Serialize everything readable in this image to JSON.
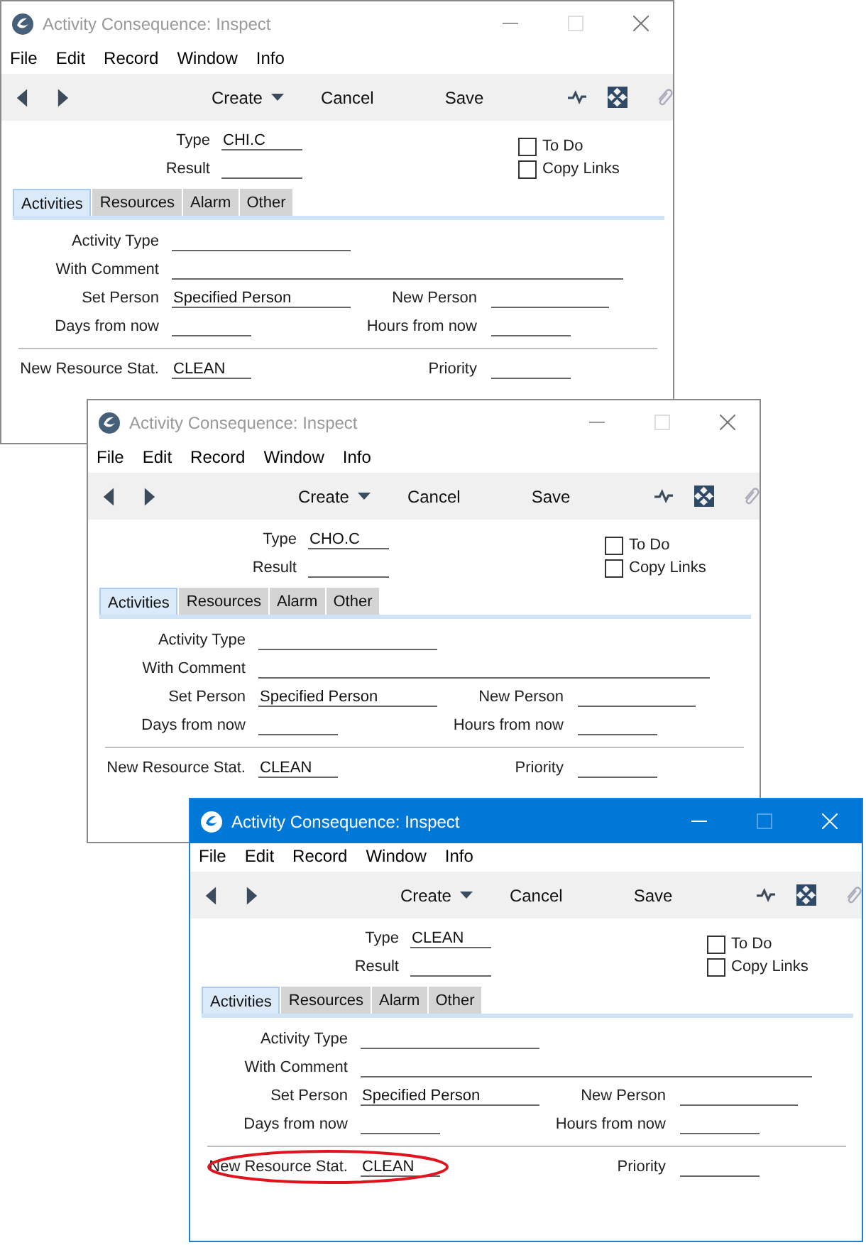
{
  "windows": [
    {
      "title": "Activity Consequence: Inspect",
      "active": false,
      "menu": [
        "File",
        "Edit",
        "Record",
        "Window",
        "Info"
      ],
      "toolbar": {
        "create": "Create",
        "cancel": "Cancel",
        "save": "Save"
      },
      "header_fields": [
        {
          "label": "Type",
          "value": "CHI.C"
        },
        {
          "label": "Result"
        }
      ],
      "checkboxes": [
        {
          "label": "To Do",
          "checked": false
        },
        {
          "label": "Copy Links",
          "checked": false
        }
      ],
      "tabs": [
        {
          "label": "Activities",
          "selected": true
        },
        {
          "label": "Resources",
          "selected": false
        },
        {
          "label": "Alarm",
          "selected": false
        },
        {
          "label": "Other",
          "selected": false
        }
      ],
      "rows": [
        {
          "left": {
            "label": "Activity Type",
            "kind": "medium"
          }
        },
        {
          "left": {
            "label": "With Comment",
            "kind": "wide"
          }
        },
        {
          "left": {
            "label": "Set Person",
            "value": "Specified Person",
            "kind": "medium"
          },
          "right": {
            "label": "New Person",
            "kind": "narrow"
          }
        },
        {
          "left": {
            "label": "Days from now",
            "kind": "short"
          },
          "right": {
            "label": "Hours from now",
            "kind": "short"
          }
        }
      ],
      "resource_row": {
        "left": {
          "label": "New Resource Stat.",
          "value": "CLEAN",
          "kind": "short",
          "circled": false
        },
        "right": {
          "label": "Priority",
          "kind": "short"
        }
      }
    },
    {
      "title": "Activity Consequence: Inspect",
      "active": false,
      "menu": [
        "File",
        "Edit",
        "Record",
        "Window",
        "Info"
      ],
      "toolbar": {
        "create": "Create",
        "cancel": "Cancel",
        "save": "Save"
      },
      "header_fields": [
        {
          "label": "Type",
          "value": "CHO.C"
        },
        {
          "label": "Result"
        }
      ],
      "checkboxes": [
        {
          "label": "To Do",
          "checked": false
        },
        {
          "label": "Copy Links",
          "checked": false
        }
      ],
      "tabs": [
        {
          "label": "Activities",
          "selected": true
        },
        {
          "label": "Resources",
          "selected": false
        },
        {
          "label": "Alarm",
          "selected": false
        },
        {
          "label": "Other",
          "selected": false
        }
      ],
      "rows": [
        {
          "left": {
            "label": "Activity Type",
            "kind": "medium"
          }
        },
        {
          "left": {
            "label": "With Comment",
            "kind": "wide"
          }
        },
        {
          "left": {
            "label": "Set Person",
            "value": "Specified Person",
            "kind": "medium"
          },
          "right": {
            "label": "New Person",
            "kind": "narrow"
          }
        },
        {
          "left": {
            "label": "Days from now",
            "kind": "short"
          },
          "right": {
            "label": "Hours from now",
            "kind": "short"
          }
        }
      ],
      "resource_row": {
        "left": {
          "label": "New Resource Stat.",
          "value": "CLEAN",
          "kind": "short",
          "circled": false
        },
        "right": {
          "label": "Priority",
          "kind": "short"
        }
      }
    },
    {
      "title": "Activity Consequence: Inspect",
      "active": true,
      "menu": [
        "File",
        "Edit",
        "Record",
        "Window",
        "Info"
      ],
      "toolbar": {
        "create": "Create",
        "cancel": "Cancel",
        "save": "Save"
      },
      "header_fields": [
        {
          "label": "Type",
          "value": "CLEAN"
        },
        {
          "label": "Result"
        }
      ],
      "checkboxes": [
        {
          "label": "To Do",
          "checked": false
        },
        {
          "label": "Copy Links",
          "checked": false
        }
      ],
      "tabs": [
        {
          "label": "Activities",
          "selected": true
        },
        {
          "label": "Resources",
          "selected": false
        },
        {
          "label": "Alarm",
          "selected": false
        },
        {
          "label": "Other",
          "selected": false
        }
      ],
      "rows": [
        {
          "left": {
            "label": "Activity Type",
            "kind": "medium"
          }
        },
        {
          "left": {
            "label": "With Comment",
            "kind": "wide"
          }
        },
        {
          "left": {
            "label": "Set Person",
            "value": "Specified Person",
            "kind": "medium"
          },
          "right": {
            "label": "New Person",
            "kind": "narrow"
          }
        },
        {
          "left": {
            "label": "Days from now",
            "kind": "short"
          },
          "right": {
            "label": "Hours from now",
            "kind": "short"
          }
        }
      ],
      "resource_row": {
        "left": {
          "label": "New Resource Stat.",
          "value": "CLEAN",
          "kind": "short",
          "circled": true
        },
        "right": {
          "label": "Priority",
          "kind": "short"
        }
      }
    }
  ]
}
